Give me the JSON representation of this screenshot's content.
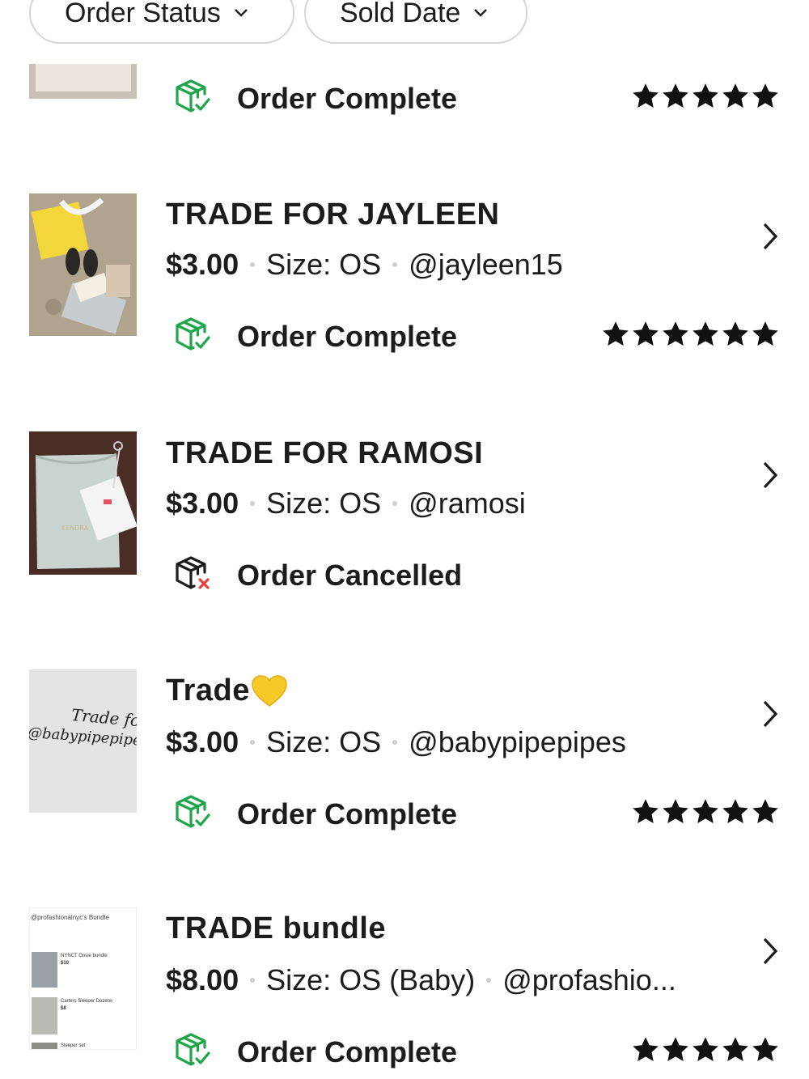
{
  "filters": {
    "order_status": "Order Status",
    "sold_date": "Sold Date"
  },
  "orders": [
    {
      "status": "Order Complete",
      "status_type": "complete",
      "rating": 5
    },
    {
      "title": "TRADE FOR JAYLEEN",
      "price": "$3.00",
      "size": "Size: OS",
      "user": "@jayleen15",
      "status": "Order Complete",
      "status_type": "complete",
      "rating": 5
    },
    {
      "title": "TRADE FOR RAMOSI",
      "price": "$3.00",
      "size": "Size: OS",
      "user": "@ramosi",
      "status": "Order Cancelled",
      "status_type": "cancelled"
    },
    {
      "title": "Trade",
      "title_emoji": "yellow-heart-icon",
      "price": "$3.00",
      "size": "Size: OS",
      "user": "@babypipepipes",
      "status": "Order Complete",
      "status_type": "complete",
      "rating": 5,
      "thumb_text": [
        "Trade for",
        "@babypipepipes"
      ]
    },
    {
      "title": "TRADE bundle",
      "price": "$8.00",
      "size": "Size: OS (Baby)",
      "user": "@profashio...",
      "status": "Order Complete",
      "status_type": "complete",
      "rating": 5,
      "thumb_text": [
        "@profashionalnyc's Bundle",
        "NYNCT Onsie bundle",
        "$10",
        "Carters Sleeper Dozens",
        "$8",
        "Sleeper set"
      ]
    }
  ],
  "colors": {
    "complete_icon": "#1fa64a",
    "cancel_mark": "#e0413a",
    "text": "#1c1c1c",
    "pill_border": "#d6d6d6"
  }
}
